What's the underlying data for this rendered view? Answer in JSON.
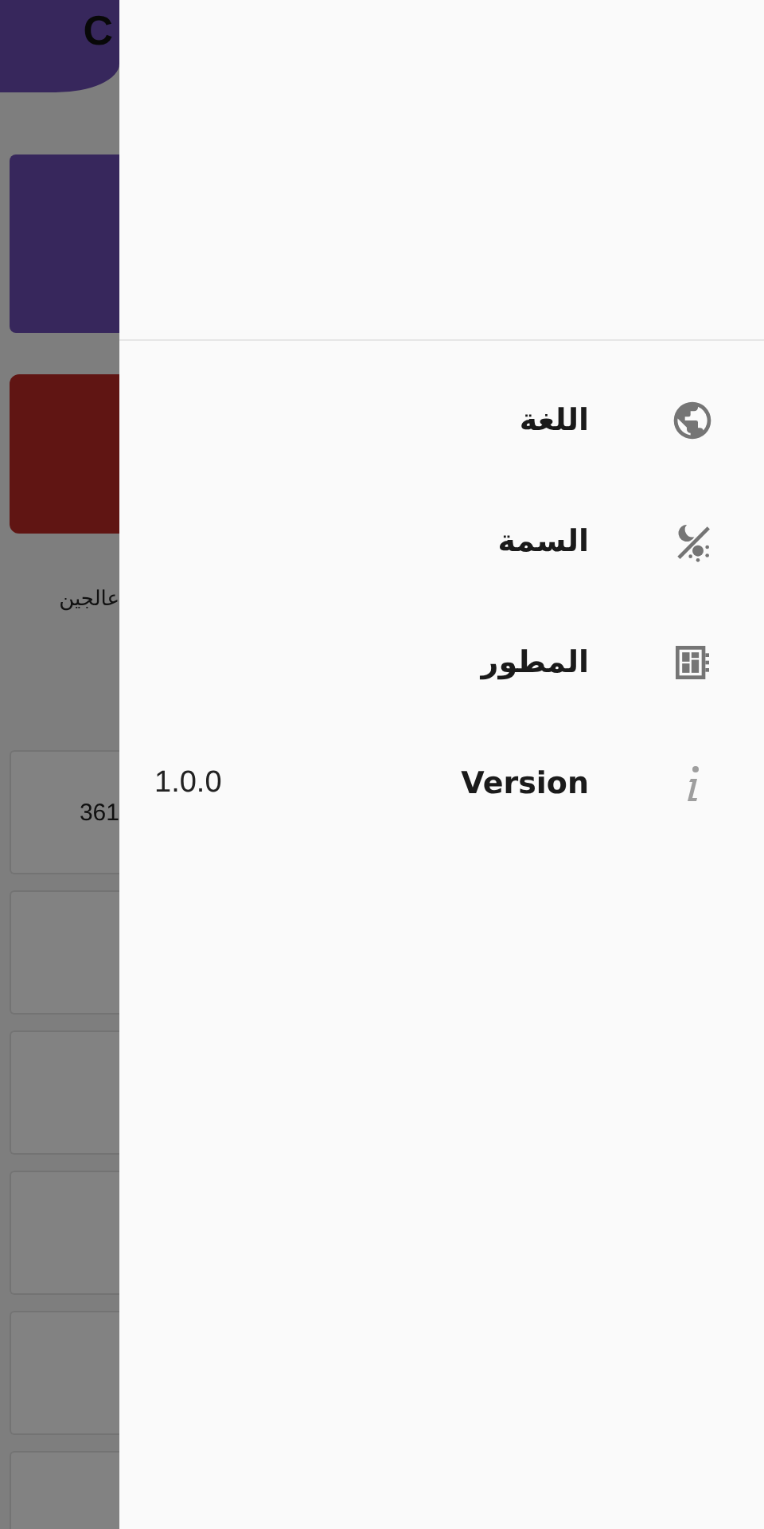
{
  "background": {
    "title": "C",
    "label": "عالجين",
    "cell": "361"
  },
  "drawer": {
    "items": [
      {
        "kind": "language",
        "label": "اللغة"
      },
      {
        "kind": "theme",
        "label": "السمة"
      },
      {
        "kind": "developer",
        "label": "المطور"
      },
      {
        "kind": "version",
        "label": "Version",
        "value": "1.0.0"
      }
    ]
  }
}
